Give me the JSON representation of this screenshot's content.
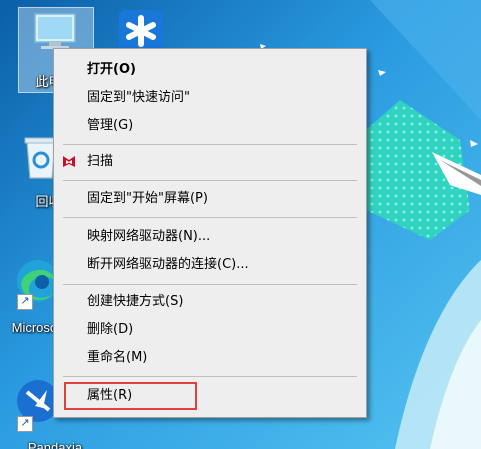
{
  "desktop": {
    "icons": [
      {
        "label": "此电脑"
      },
      {
        "label": "回收站"
      },
      {
        "label": "Microsoft Edge"
      },
      {
        "label": "Pandaxia"
      }
    ]
  },
  "context_menu": {
    "items": [
      {
        "label": "打开(O)",
        "bold": true
      },
      {
        "label": "固定到\"快速访问\""
      },
      {
        "label": "管理(G)"
      },
      {
        "label": "扫描",
        "icon": "mcafee-icon"
      },
      {
        "label": "固定到\"开始\"屏幕(P)"
      },
      {
        "label": "映射网络驱动器(N)..."
      },
      {
        "label": "断开网络驱动器的连接(C)..."
      },
      {
        "label": "创建快捷方式(S)"
      },
      {
        "label": "删除(D)"
      },
      {
        "label": "重命名(M)"
      },
      {
        "label": "属性(R)",
        "highlighted": true
      }
    ]
  },
  "colors": {
    "menu_bg": "#eeeeee",
    "highlight_border": "#e04040",
    "accent_teal": "#2fd3c0"
  }
}
